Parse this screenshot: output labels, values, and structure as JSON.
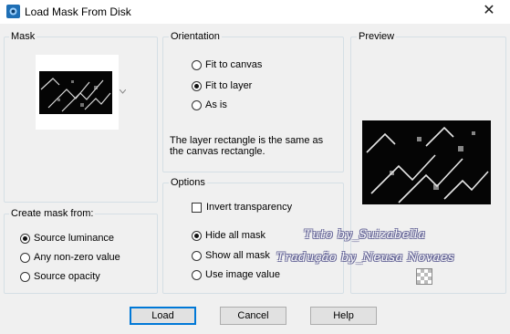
{
  "window": {
    "title": "Load Mask From Disk",
    "close_symbol": "✕"
  },
  "mask": {
    "label": "Mask"
  },
  "orientation": {
    "label": "Orientation",
    "options": [
      {
        "label": "Fit to canvas",
        "selected": false
      },
      {
        "label": "Fit to layer",
        "selected": true
      },
      {
        "label": "As is",
        "selected": false
      }
    ],
    "description": "The layer rectangle is the same as the canvas rectangle."
  },
  "preview": {
    "label": "Preview"
  },
  "create_mask": {
    "label": "Create mask from:",
    "options": [
      {
        "label": "Source luminance",
        "selected": true
      },
      {
        "label": "Any non-zero value",
        "selected": false
      },
      {
        "label": "Source opacity",
        "selected": false
      }
    ]
  },
  "options": {
    "label": "Options",
    "invert_transparency": {
      "label": "Invert transparency",
      "checked": false
    },
    "mask_options": [
      {
        "label": "Hide all mask",
        "selected": true
      },
      {
        "label": "Show all mask",
        "selected": false
      },
      {
        "label": "Use image value",
        "selected": false
      }
    ]
  },
  "buttons": {
    "load": "Load",
    "cancel": "Cancel",
    "help": "Help"
  },
  "watermark": {
    "line1": "Tuto by_Suizabella",
    "line2": "Tradução by_Neusa Novaes"
  }
}
